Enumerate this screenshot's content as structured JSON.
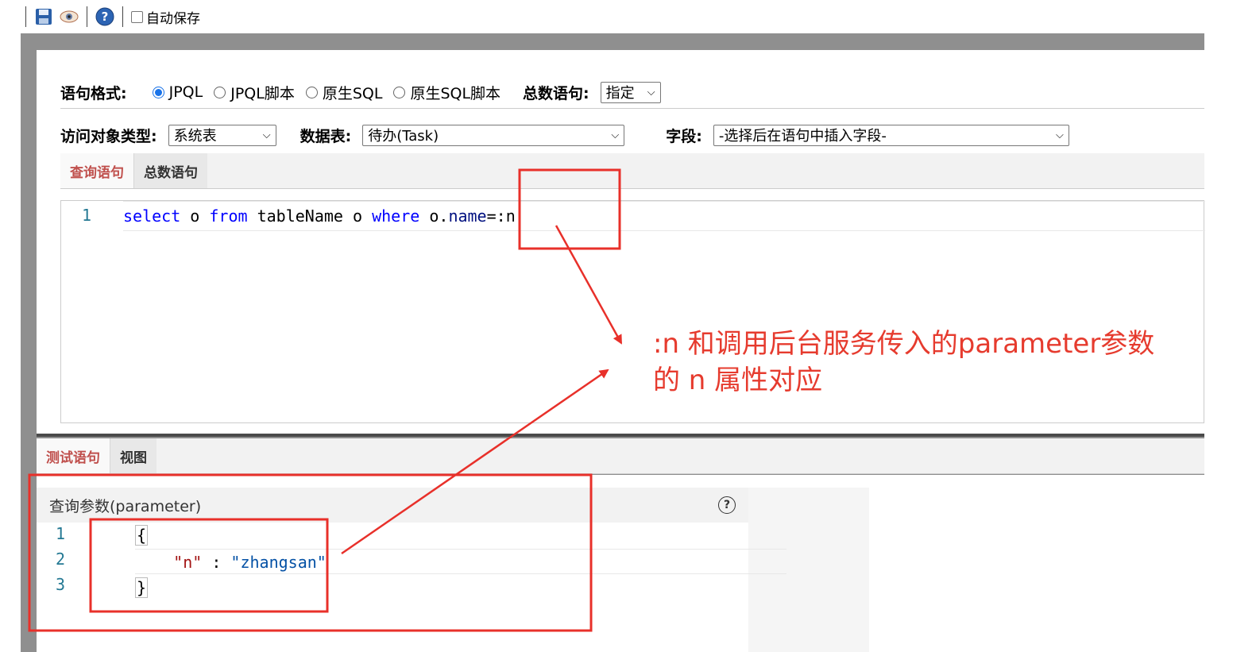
{
  "toolbar": {
    "icons": [
      "save-icon",
      "eye-icon",
      "help-icon"
    ],
    "autosave_label": "自动保存"
  },
  "form": {
    "syntax_label": "语句格式:",
    "syntax_options": [
      "JPQL",
      "JPQL脚本",
      "原生SQL",
      "原生SQL脚本"
    ],
    "syntax_selected": "JPQL",
    "count_label": "总数语句:",
    "count_value": "指定",
    "object_type_label": "访问对象类型:",
    "object_type_value": "系统表",
    "table_label": "数据表:",
    "table_value": "待办(Task)",
    "field_label": "字段:",
    "field_value": "-选择后在语句中插入字段-"
  },
  "query_tabs": [
    "查询语句",
    "总数语句"
  ],
  "query_tab_active": "查询语句",
  "query_editor": {
    "line_number": "1",
    "tokens": {
      "select": "select",
      "o1": " o ",
      "from": "from",
      "table": " tableName o ",
      "where": "where",
      "o2": " o.",
      "name": "name",
      "rest": "=:n"
    }
  },
  "bottom_tabs": [
    "测试语句",
    "视图"
  ],
  "bottom_tab_active": "测试语句",
  "param_panel": {
    "title": "查询参数(parameter)",
    "lines": [
      "1",
      "2",
      "3"
    ],
    "open_brace": "{",
    "key": "\"n\"",
    "colon": " : ",
    "value": "\"zhangsan\"",
    "close_brace": "}"
  },
  "annotation": {
    "line1": ":n 和调用后台服务传入的parameter参数",
    "line2": "的 n 属性对应",
    "color": "#e63b2e"
  }
}
